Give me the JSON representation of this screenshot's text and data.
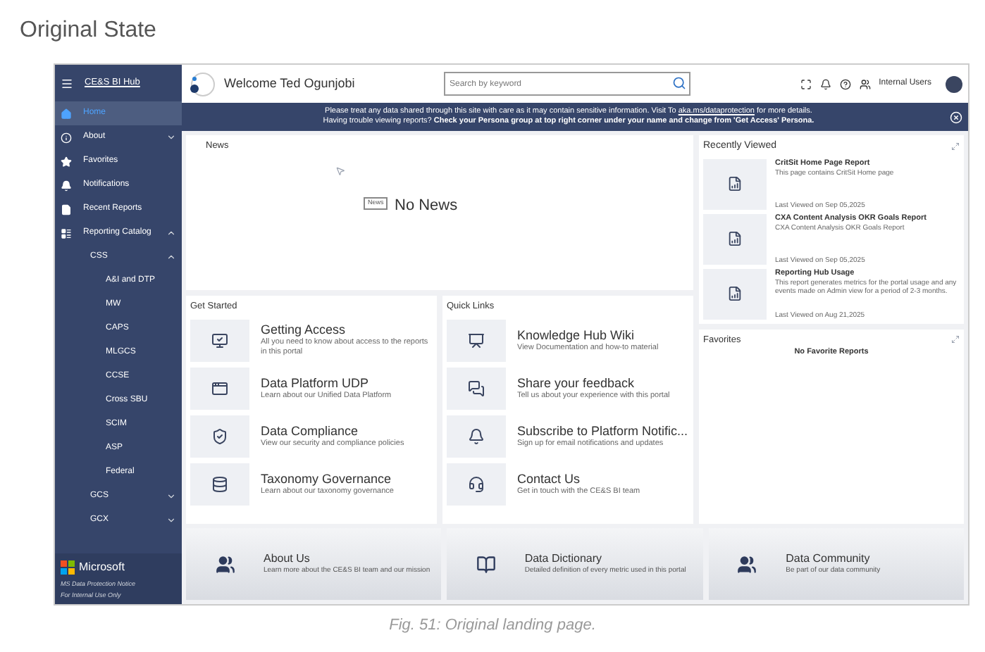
{
  "doc_title": "Original State",
  "app": {
    "brand": "CE&S BI Hub",
    "welcome": "Welcome Ted Ogunjobi",
    "search": {
      "placeholder": "Search by keyword"
    },
    "user_group": "Internal Users",
    "banner": {
      "line1_before": "Please treat any data shared through this site with care as it may contain sensitive information. Visit To ",
      "link": "aka.ms/dataprotection",
      "line1_after": " for more details.",
      "line2": "Having trouble viewing reports? **Check your Persona group at top right corner under your name and change from 'Get Access' Persona.**"
    },
    "sidebar": {
      "items": [
        {
          "label": "Home",
          "selected": true
        },
        {
          "label": "About",
          "selected": false,
          "expanded": false
        },
        {
          "label": "Favorites",
          "selected": false
        },
        {
          "label": "Notifications",
          "selected": false
        },
        {
          "label": "Recent Reports",
          "selected": false
        },
        {
          "label": "Reporting Catalog",
          "selected": false,
          "expanded": true,
          "children": [
            {
              "label": "CSS",
              "selected": false,
              "expanded": true,
              "children": [
                {
                  "label": "A&I and DTP",
                  "selected": false
                },
                {
                  "label": "MW",
                  "selected": false
                },
                {
                  "label": "CAPS",
                  "selected": false
                },
                {
                  "label": "MLGCS",
                  "selected": false
                },
                {
                  "label": "CCSE",
                  "selected": false
                },
                {
                  "label": "Cross SBU",
                  "selected": false
                },
                {
                  "label": "SCIM",
                  "selected": false
                },
                {
                  "label": "ASP",
                  "selected": false
                },
                {
                  "label": "Federal",
                  "selected": false
                }
              ]
            },
            {
              "label": "GCS",
              "selected": false,
              "expanded": false
            },
            {
              "label": "GCX",
              "selected": false,
              "expanded": false
            }
          ]
        }
      ],
      "footer_brand": "Microsoft",
      "footer_notice": "MS Data Protection Notice",
      "footer_note": "For Internal Use Only"
    },
    "news": {
      "title": "News",
      "empty": "No News",
      "tooltip": "News"
    },
    "get_started": {
      "title": "Get Started",
      "items": [
        {
          "title": "Getting Access",
          "desc": "All you need to know about access to the reports in this portal"
        },
        {
          "title": "Data Platform UDP",
          "desc": "Learn about our Unified Data Platform"
        },
        {
          "title": "Data Compliance",
          "desc": "View our security and compliance policies"
        },
        {
          "title": "Taxonomy Governance",
          "desc": "Learn about our taxonomy governance"
        }
      ]
    },
    "quick_links": {
      "title": "Quick Links",
      "items": [
        {
          "title": "Knowledge Hub Wiki",
          "desc": "View Documentation and how-to material"
        },
        {
          "title": "Share your feedback",
          "desc": "Tell us about your experience with this portal"
        },
        {
          "title": "Subscribe to Platform Notific...",
          "desc": "Sign up for email notifications and updates"
        },
        {
          "title": "Contact Us",
          "desc": "Get in touch with the CE&S BI team"
        }
      ]
    },
    "recently_viewed": {
      "title": "Recently Viewed",
      "items": [
        {
          "title": "CritSit Home Page Report",
          "desc": "This page contains CritSit Home page",
          "viewed": "Last Viewed on Sep 05,2025"
        },
        {
          "title": "CXA Content Analysis OKR Goals Report",
          "desc": "CXA Content Analysis OKR Goals Report",
          "viewed": "Last Viewed on Sep 05,2025"
        },
        {
          "title": "Reporting Hub Usage",
          "desc": "This report generates metrics for the portal usage and any events made on Admin view for a period of 2-3 months.",
          "viewed": "Last Viewed on Aug 21,2025"
        }
      ]
    },
    "favorites": {
      "title": "Favorites",
      "empty": "No Favorite Reports"
    },
    "bottom_links": [
      {
        "title": "About Us",
        "desc": "Learn more about the CE&S BI team and our mission"
      },
      {
        "title": "Data Dictionary",
        "desc": "Detailed definition of every metric used in this portal"
      },
      {
        "title": "Data Community",
        "desc": "Be part of our data community"
      }
    ]
  },
  "caption": "Fig. 51: Original landing page."
}
